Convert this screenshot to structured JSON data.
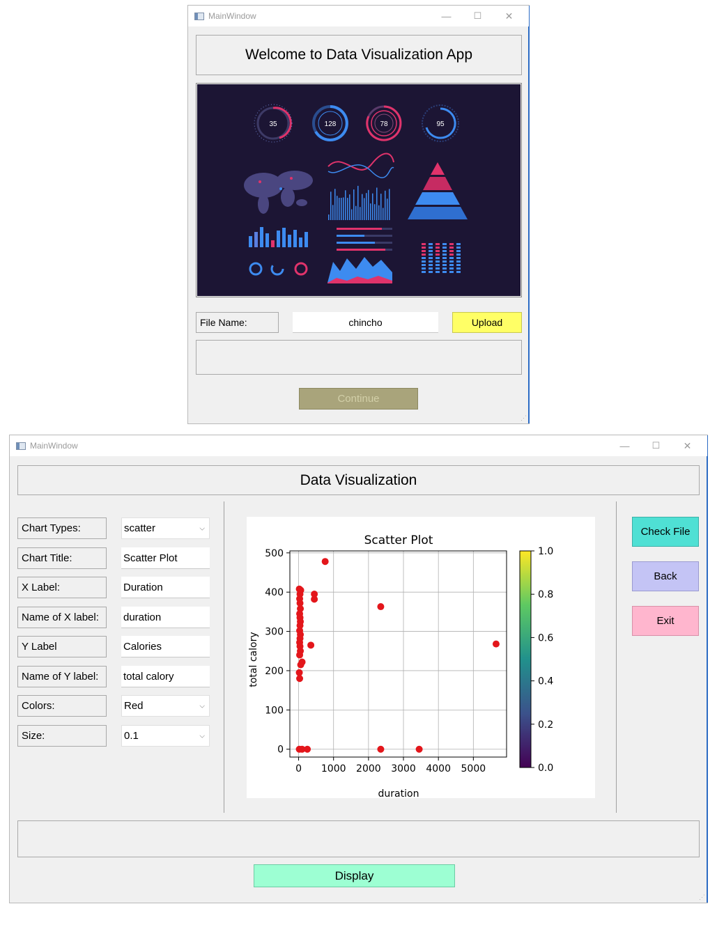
{
  "window1": {
    "title": "MainWindow",
    "controls": {
      "minimize": "—",
      "maximize": "☐",
      "close": "✕"
    },
    "heading": "Welcome to Data Visualization App",
    "dashboard_image": {
      "gauges": [
        "35",
        "128",
        "78",
        "95"
      ],
      "colors": {
        "background": "#1c1534",
        "pink": "#e0336b",
        "blue": "#3d8bf0"
      }
    },
    "file_label": "File Name:",
    "file_value": "chincho",
    "upload_button": "Upload",
    "status_text": "",
    "continue_button": "Continue",
    "colors": {
      "upload": "#ffff66",
      "continue": "#a9a47b",
      "continue_text": "#c9c59c"
    }
  },
  "window2": {
    "title": "MainWindow",
    "controls": {
      "minimize": "—",
      "maximize": "☐",
      "close": "✕"
    },
    "heading": "Data Visualization",
    "form": {
      "chart_types_label": "Chart Types:",
      "chart_types_value": "scatter",
      "chart_title_label": "Chart Title:",
      "chart_title_value": "Scatter Plot",
      "x_label_label": "X Label:",
      "x_label_value": "Duration",
      "x_name_label": "Name of X label:",
      "x_name_value": "duration",
      "y_label_label": "Y Label",
      "y_label_value": "Calories",
      "y_name_label": "Name of Y label:",
      "y_name_value": "total calory",
      "colors_label": "Colors:",
      "colors_value": "Red",
      "size_label": "Size:",
      "size_value": "0.1"
    },
    "buttons": {
      "check_file": "Check File",
      "back": "Back",
      "exit": "Exit",
      "display": "Display"
    },
    "status_text": "",
    "colors": {
      "check_file": "#4fe0d4",
      "back": "#c4c4f5",
      "exit": "#ffb6ce",
      "display": "#9dffd3"
    }
  },
  "chart_data": {
    "type": "scatter",
    "title": "Scatter Plot",
    "xlabel": "duration",
    "ylabel": "total calory",
    "xlim": [
      -250,
      5950
    ],
    "ylim": [
      -20,
      505
    ],
    "xticks": [
      "0",
      "1000",
      "2000",
      "3000",
      "4000",
      "5000"
    ],
    "xtick_values": [
      0,
      1000,
      2000,
      3000,
      4000,
      5000
    ],
    "yticks": [
      "0",
      "100",
      "200",
      "300",
      "400",
      "500"
    ],
    "ytick_values": [
      0,
      100,
      200,
      300,
      400,
      500
    ],
    "grid": true,
    "point_color": "#e3161b",
    "colorbar": {
      "ticks": [
        "0.0",
        "0.2",
        "0.4",
        "0.6",
        "0.8",
        "1.0"
      ],
      "tick_values": [
        0.0,
        0.2,
        0.4,
        0.6,
        0.8,
        1.0
      ],
      "colormap": "viridis"
    },
    "x": [
      760,
      20,
      60,
      40,
      30,
      40,
      50,
      30,
      40,
      50,
      40,
      30,
      50,
      40,
      30,
      40,
      50,
      30,
      100,
      20,
      30,
      60,
      350,
      450,
      450,
      2350,
      5650,
      20,
      100,
      250,
      2350,
      3450
    ],
    "y": [
      478,
      408,
      405,
      395,
      383,
      372,
      358,
      345,
      335,
      325,
      315,
      302,
      292,
      282,
      272,
      262,
      250,
      240,
      222,
      195,
      180,
      215,
      265,
      395,
      382,
      363,
      268,
      0,
      0,
      0,
      0,
      0
    ]
  }
}
